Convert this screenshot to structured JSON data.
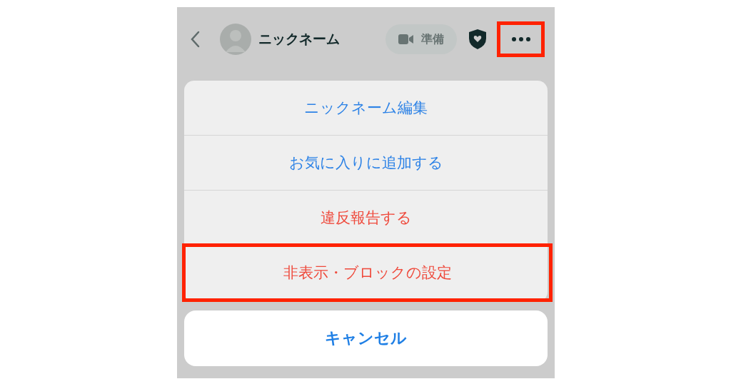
{
  "header": {
    "name": "ニックネーム",
    "call_button": {
      "label": "準備"
    },
    "more_button": {
      "highlighted": true
    }
  },
  "actions": [
    {
      "label": "ニックネーム編集",
      "kind": "default",
      "highlighted": false
    },
    {
      "label": "お気に入りに追加する",
      "kind": "default",
      "highlighted": false
    },
    {
      "label": "違反報告する",
      "kind": "destructive",
      "highlighted": false
    },
    {
      "label": "非表示・ブロックの設定",
      "kind": "destructive",
      "highlighted": true
    }
  ],
  "cancel": {
    "label": "キャンセル"
  }
}
